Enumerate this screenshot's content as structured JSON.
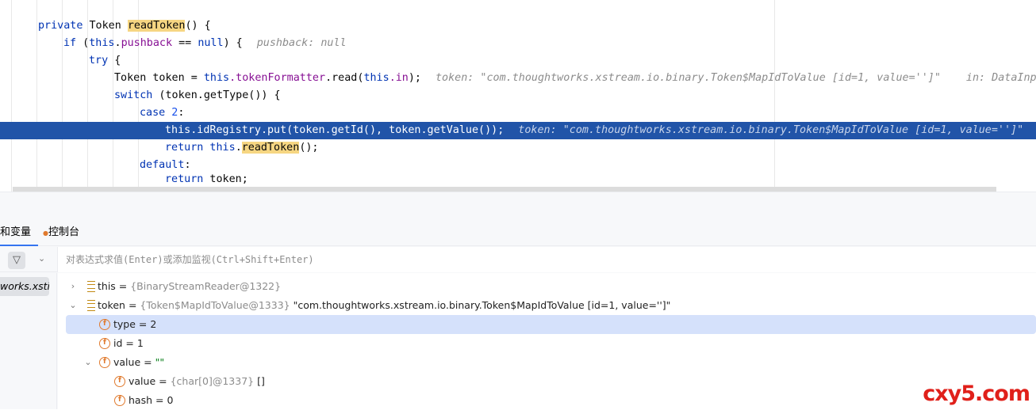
{
  "code": {
    "l1": {
      "kw": "private",
      "type": " Token ",
      "method": "readToken",
      "rest": "() {"
    },
    "l2": {
      "a": "if (",
      "this": "this",
      "dot": ".",
      "field": "pushback",
      "b": " == ",
      "null": "null",
      "c": ") {",
      "hint": "pushback: null"
    },
    "l3": {
      "kw": "try",
      "rest": " {"
    },
    "l4": {
      "a": "Token token = ",
      "this": "this",
      "field": ".tokenFormatter",
      "b": ".read(",
      "this2": "this",
      "field2": ".in",
      "c": ");",
      "hint": "token: \"com.thoughtworks.xstream.io.binary.Token$MapIdToValue [id=1, value='']\"",
      "hint2": "in: DataInpu"
    },
    "l5": {
      "kw": "switch",
      "rest": " (token.getType()) {"
    },
    "l6": {
      "kw": "case",
      "num": " 2",
      "rest": ":"
    },
    "l7": {
      "this": "this",
      "field": ".idRegistry",
      "rest": ".put(token.getId(), token.getValue());",
      "hint": "token: \"com.thoughtworks.xstream.io.binary.Token$MapIdToValue [id=1, value='']\""
    },
    "l8": {
      "kw": "return",
      "this": " this",
      "dot": ".",
      "method": "readToken",
      "rest": "();"
    },
    "l9": {
      "kw": "default",
      "rest": ":"
    },
    "l10": {
      "kw": "return",
      "rest": " token;"
    }
  },
  "tabs": {
    "variables": "和变量",
    "console": "控制台"
  },
  "eval_placeholder": "对表达式求值(Enter)或添加监视(Ctrl+Shift+Enter)",
  "frame_label": "works.xsti",
  "tree": [
    {
      "name": "this",
      "eq": " = ",
      "type": "{BinaryStreamReader@1322}",
      "val": ""
    },
    {
      "name": "token",
      "eq": " = ",
      "type": "{Token$MapIdToValue@1333}",
      "val": " \"com.thoughtworks.xstream.io.binary.Token$MapIdToValue [id=1, value='']\""
    },
    {
      "name": "type",
      "eq": " = ",
      "val": "2"
    },
    {
      "name": "id",
      "eq": " = ",
      "val": "1"
    },
    {
      "name": "value",
      "eq": " = ",
      "val": "\"\""
    },
    {
      "name": "value",
      "eq": " = ",
      "type": "{char[0]@1337}",
      "val": " []"
    },
    {
      "name": "hash",
      "eq": " = ",
      "val": "0"
    }
  ],
  "watermark": "cxy5.com"
}
